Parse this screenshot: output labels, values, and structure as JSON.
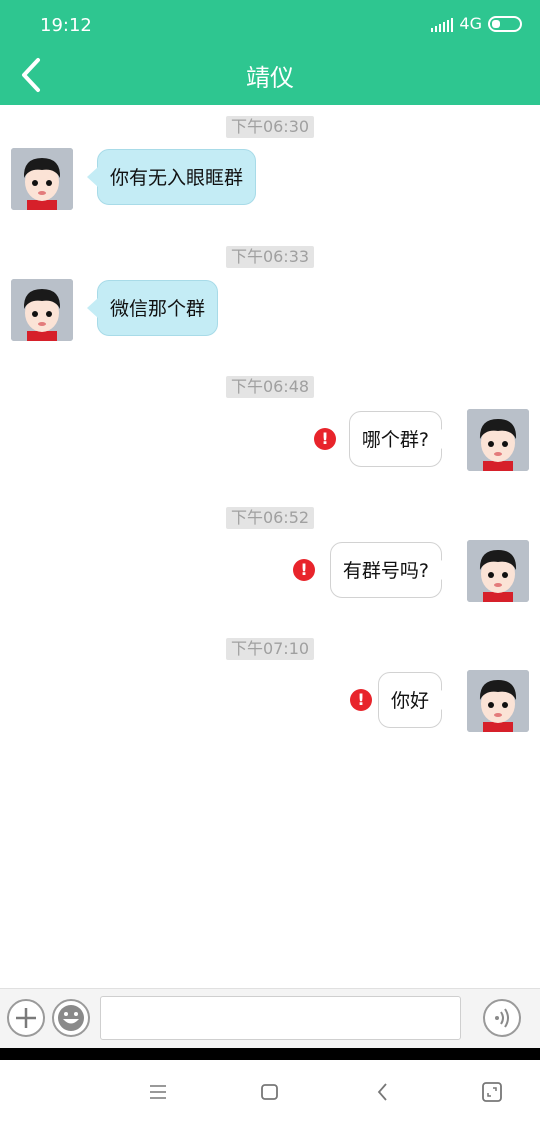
{
  "status": {
    "time": "19:12",
    "network": "4G"
  },
  "header": {
    "title": "靖仪"
  },
  "messages": [
    {
      "time": "下午06:30",
      "direction": "in",
      "text": "你有无入眼眶群"
    },
    {
      "time": "下午06:33",
      "direction": "in",
      "text": "微信那个群"
    },
    {
      "time": "下午06:48",
      "direction": "out",
      "text": "哪个群?",
      "failed": true
    },
    {
      "time": "下午06:52",
      "direction": "out",
      "text": "有群号吗?",
      "failed": true
    },
    {
      "time": "下午07:10",
      "direction": "out",
      "text": "你好",
      "failed": true
    }
  ],
  "icons": {
    "back": "chevron-left-icon",
    "plus": "plus-icon",
    "emoji": "emoji-icon",
    "voice": "voice-icon",
    "error": "exclamation-icon"
  },
  "input": {
    "value": "",
    "placeholder": ""
  },
  "colors": {
    "accent": "#2ec690",
    "bubble_in": "#c4ecf5",
    "error": "#e8242b"
  }
}
